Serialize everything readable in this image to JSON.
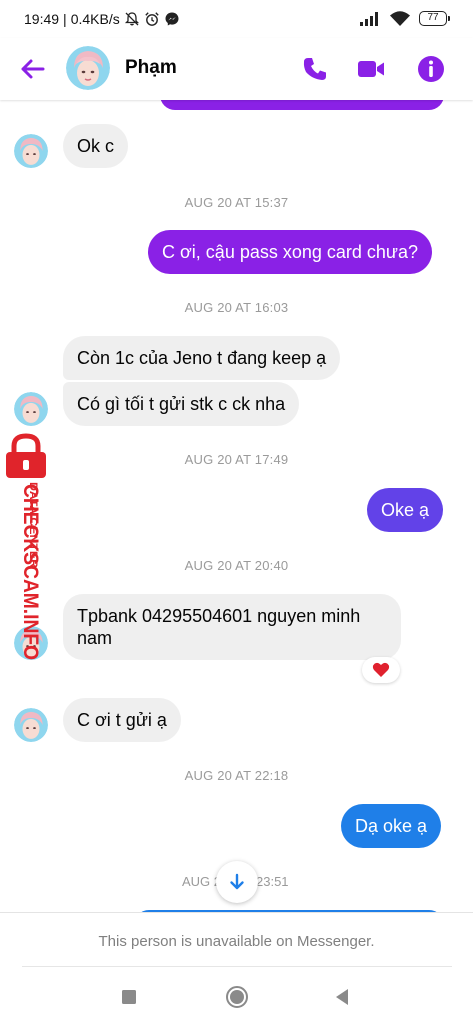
{
  "status_bar": {
    "time": "19:49",
    "separator": "|",
    "network_speed": "0.4KB/s",
    "battery_level": "77",
    "icons": [
      "mute-icon",
      "alarm-icon",
      "messenger-icon",
      "signal-icon",
      "wifi-icon",
      "battery-icon"
    ]
  },
  "header": {
    "contact_name": "Phạm",
    "actions": [
      "back-arrow-icon",
      "phone-icon",
      "video-camera-icon",
      "info-icon"
    ],
    "accent_color": "#8a21e6"
  },
  "messages": [
    {
      "type": "incoming",
      "text": "Ok c"
    },
    {
      "type": "timestamp",
      "text": "AUG 20 AT 15:37"
    },
    {
      "type": "outgoing",
      "text": "C ơi, cậu pass xong card chưa?"
    },
    {
      "type": "timestamp",
      "text": "AUG 20 AT 16:03"
    },
    {
      "type": "incoming",
      "text": "Còn 1c của Jeno t đang keep ạ"
    },
    {
      "type": "incoming",
      "text": "Có gì tối t gửi stk c ck nha"
    },
    {
      "type": "timestamp",
      "text": "AUG 20 AT 17:49"
    },
    {
      "type": "outgoing",
      "text": "Oke ạ"
    },
    {
      "type": "timestamp",
      "text": "AUG 20 AT 20:40"
    },
    {
      "type": "incoming",
      "text_line1": "Tpbank 04295504601 nguyen minh",
      "text_line2": "nam",
      "reaction": "heart"
    },
    {
      "type": "incoming",
      "text": "C ơi t gửi ạ"
    },
    {
      "type": "timestamp",
      "text": "AUG 20 AT 22:18"
    },
    {
      "type": "outgoing",
      "text": "Dạ oke ạ"
    },
    {
      "type": "timestamp_partial",
      "left": "AUG 2",
      "right": "23:51"
    }
  ],
  "watermark": {
    "main": "CHECKSCAM.INFO",
    "sub": "DATA CENTER",
    "color": "#e0242b"
  },
  "footer": {
    "notice": "This person is unavailable on Messenger."
  },
  "colors": {
    "outgoing_purple": "#8a21e6",
    "outgoing_violet": "#6242e8",
    "outgoing_blue": "#1f7fe8",
    "incoming_bg": "#efefef"
  }
}
